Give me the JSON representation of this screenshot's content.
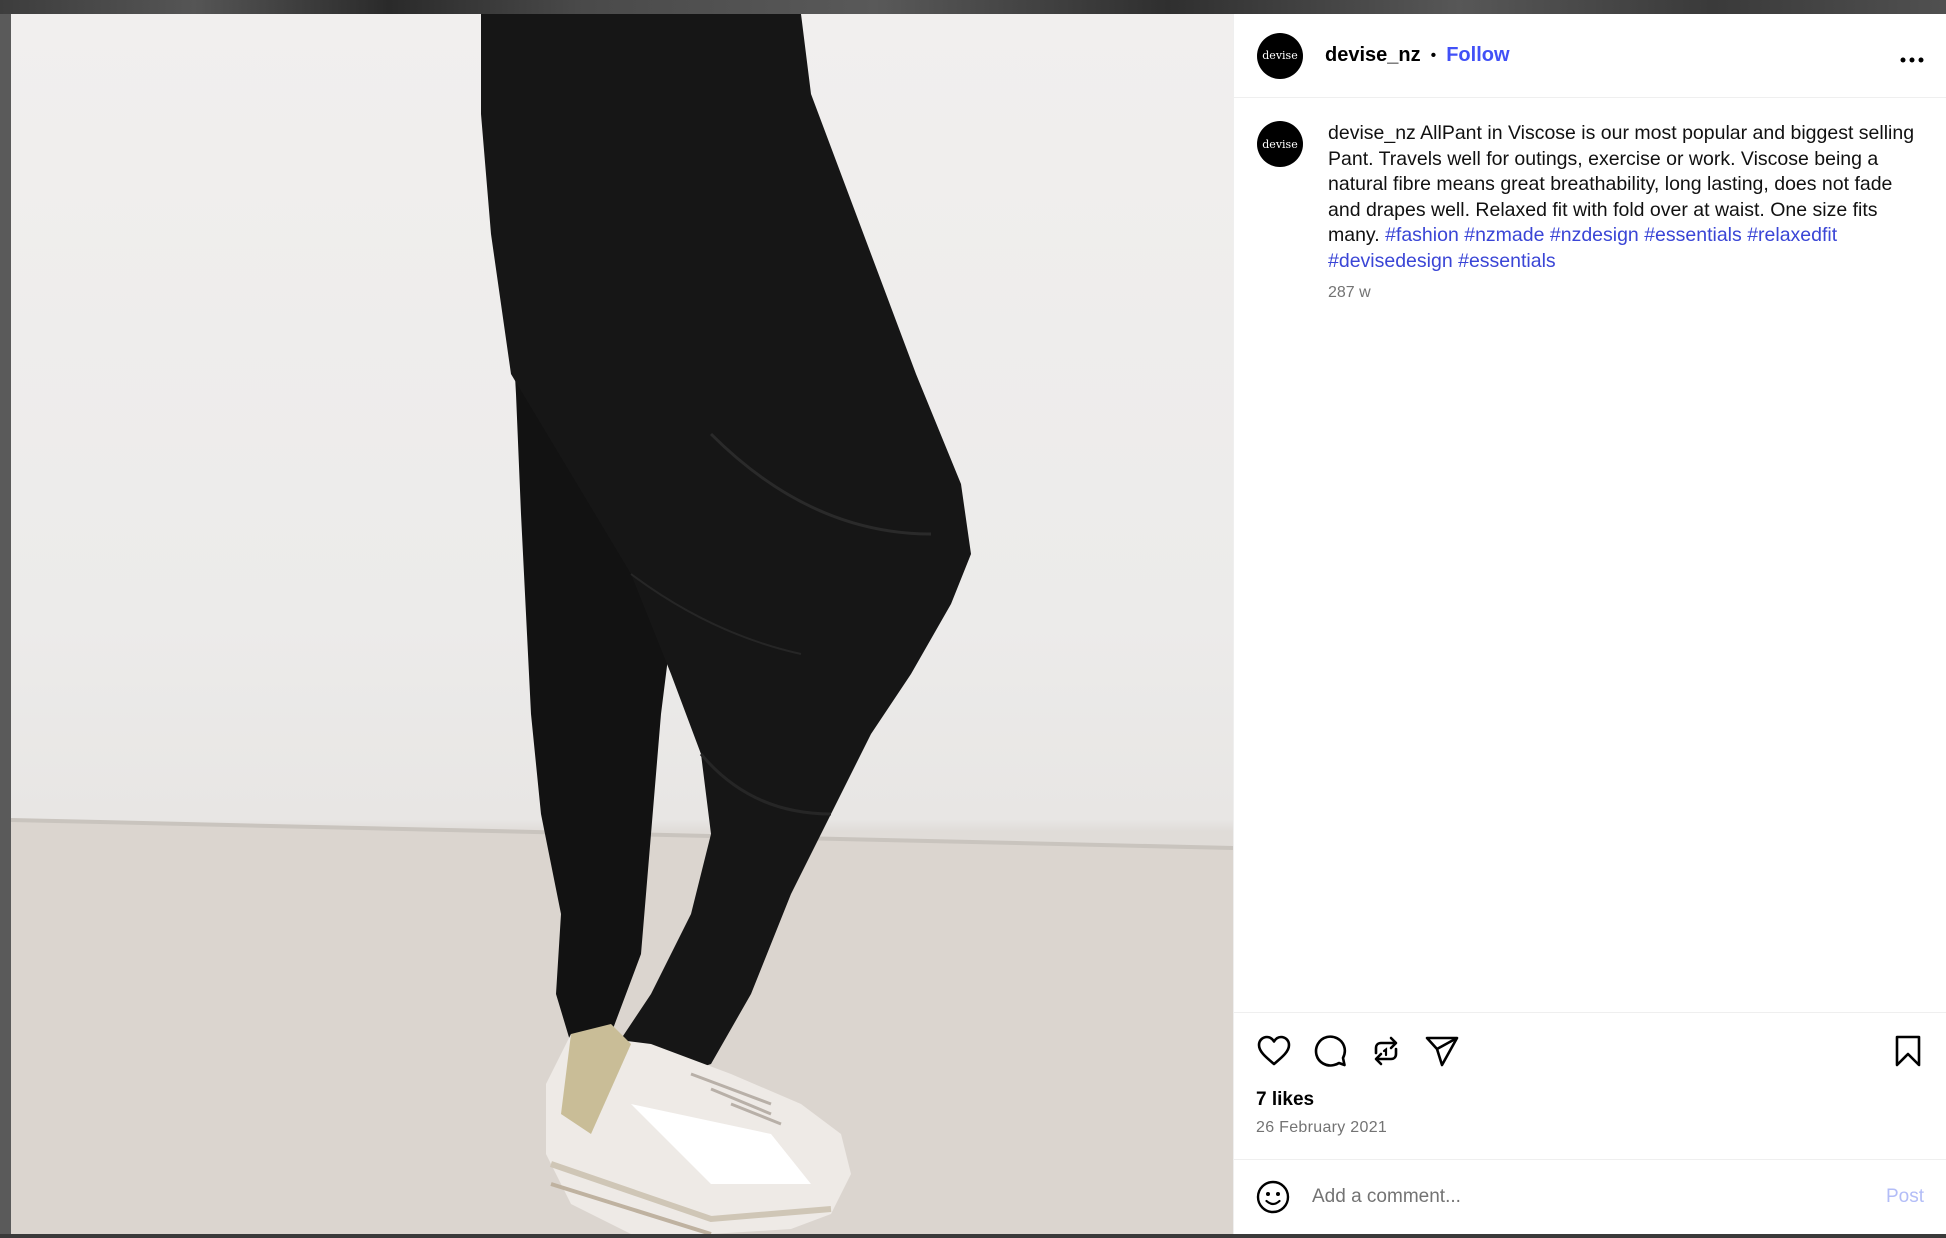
{
  "post": {
    "username": "devise_nz",
    "avatar_text": "devise",
    "separator": "•",
    "follow_label": "Follow",
    "more_label": "•••",
    "caption": {
      "username": "devise_nz",
      "text": "AllPant in Viscose is our most popular and biggest selling Pant. Travels well for outings, exercise or work. Viscose being a natural fibre means great breathability, long lasting, does not fade and drapes well. Relaxed fit with fold over at waist. One size fits many.",
      "hashtags": [
        "#fashion",
        "#nzmade",
        "#nzdesign",
        "#essentials",
        "#relaxedfit",
        "#devisedesign",
        "#essentials"
      ]
    },
    "time_ago": "287 w",
    "likes": "7 likes",
    "date": "26 February 2021",
    "comment_placeholder": "Add a comment...",
    "post_label": "Post"
  },
  "icons": {
    "like": "heart-icon",
    "comment": "comment-icon",
    "repost": "repost-icon",
    "share": "share-icon",
    "save": "bookmark-icon",
    "emoji": "emoji-icon"
  },
  "colors": {
    "link": "#4150f7",
    "hashtag": "#3a45d6",
    "muted": "#737373",
    "post_disabled": "#b3bdf7"
  }
}
